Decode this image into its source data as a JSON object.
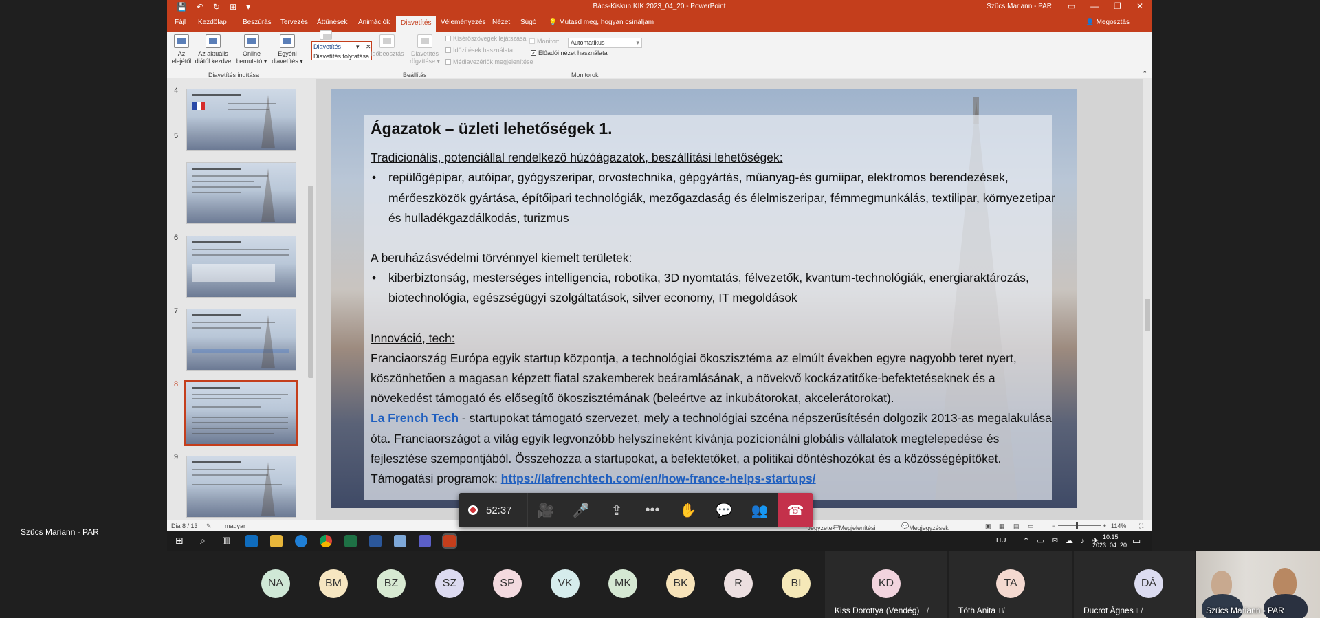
{
  "window": {
    "title": "Bács-Kiskun KIK 2023_04_20  -  PowerPoint",
    "user": "Szűcs Mariann - PAR"
  },
  "tabs": [
    "Fájl",
    "Kezdőlap",
    "Beszúrás",
    "Tervezés",
    "Áttűnések",
    "Animációk",
    "Diavetítés",
    "Véleményezés",
    "Nézet",
    "Súgó"
  ],
  "tell_me": "Mutasd meg, hogyan csináljam",
  "share": "Megosztás",
  "ribbon": {
    "from_start": [
      "Az",
      "elejétől"
    ],
    "from_current": [
      "Az aktuális",
      "diától kezdve"
    ],
    "online": [
      "Online",
      "bemutató ▾"
    ],
    "custom": [
      "Egyéni",
      "diavetítés ▾"
    ],
    "group_start": "Diavetítés indítása",
    "dropdown_value": "Diavetítés",
    "dropdown_sub": "Diavetítés folytatása",
    "rehearse": "Időbeosztás",
    "record": [
      "Diavetítés",
      "rögzítése ▾"
    ],
    "chk_narrations": "Kísérőszövegek lejátszása",
    "chk_timings": "Időzítések használata",
    "chk_media": "Médiavezérlők megjelenítése",
    "group_setup": "Beállítás",
    "monitor_label": "Monitor:",
    "monitor_value": "Automatikus",
    "presenter_view": "Előadói nézet használata",
    "group_monitors": "Monitorok"
  },
  "thumbnails": [
    "4",
    "5",
    "6",
    "7",
    "8",
    "9"
  ],
  "slide": {
    "title": "Ágazatok – üzleti lehetőségek 1.",
    "h1": "Tradicionális, potenciállal rendelkező húzóágazatok, beszállítási lehetőségek:",
    "b1": "repülőgépipar, autóipar, gyógyszeripar, orvostechnika, gépgyártás, műanyag-és gumiipar, elektromos berendezések, mérőeszközök gyártása, építőipari technológiák, mezőgazdaság és élelmiszeripar, fémmegmunkálás, textilipar, környezetipar és hulladékgazdálkodás, turizmus",
    "h2": "A beruházásvédelmi törvénnyel kiemelt területek:",
    "b2": "kiberbiztonság, mesterséges intelligencia, robotika, 3D nyomtatás, félvezetők, kvantum-technológiák, energiaraktározás, biotechnológia, egészségügyi szolgáltatások, silver economy, IT megoldások",
    "h3": "Innováció, tech:",
    "p1": "Franciaország Európa egyik startup központja, a technológiai ökoszisztéma az elmúlt években egyre nagyobb teret nyert, köszönhetően a magasan képzett fiatal szakemberek beáramlásának, a növekvő kockázatitőke-befektetéseknek és a növekedést támogató és elősegítő ökoszisztémának (beleértve az inkubátorokat, akcelerátorokat).",
    "link1": "La French Tech",
    "p2": " - startupokat támogató szervezet, mely a technológiai szcéna népszerűsítésén dolgozik 2013-as megalakulása óta. Franciaországot a világ egyik legvonzóbb helyszíneként kívánja pozícionálni globális vállalatok megtelepedése és fejlesztése szempontjából. Összehozza a startupokat, a befektetőket, a politikai döntéshozókat és a közösségépítőket. Támogatási programok: ",
    "link2": "https://lafrenchtech.com/en/how-france-helps-startups/"
  },
  "status": {
    "slide_of": "Dia 8 / 13",
    "language": "magyar",
    "notes": "Jegyzetek",
    "display_settings": "Megjelenítési beállítások",
    "comments": "Megjegyzések",
    "zoom": "114%"
  },
  "taskbar": {
    "lang": "HU",
    "time": "10:15",
    "date": "2023. 04. 20."
  },
  "meeting": {
    "timer": "52:37",
    "presenter_name": "Szűcs Mariann - PAR",
    "avatars": [
      {
        "initials": "NA",
        "color": "#cfe8d6"
      },
      {
        "initials": "BM",
        "color": "#f6e6c1"
      },
      {
        "initials": "BZ",
        "color": "#d7e9d2"
      },
      {
        "initials": "SZ",
        "color": "#dcdaf0"
      },
      {
        "initials": "SP",
        "color": "#f3dadf"
      },
      {
        "initials": "VK",
        "color": "#d6ecec"
      },
      {
        "initials": "MK",
        "color": "#d5e8d3"
      },
      {
        "initials": "BK",
        "color": "#f7e3b9"
      },
      {
        "initials": "R",
        "color": "#ecdfe0"
      },
      {
        "initials": "BI",
        "color": "#f5e8b8"
      }
    ],
    "named_tiles": [
      {
        "initials": "KD",
        "name": "Kiss Dorottya (Vendég)",
        "color": "#f2d4de"
      },
      {
        "initials": "TA",
        "name": "Tóth Anita",
        "color": "#f4d9d0"
      },
      {
        "initials": "DÁ",
        "name": "Ducrot Ágnes",
        "color": "#dcdcf0"
      }
    ],
    "self_name": "Szűcs Mariann - PAR"
  }
}
